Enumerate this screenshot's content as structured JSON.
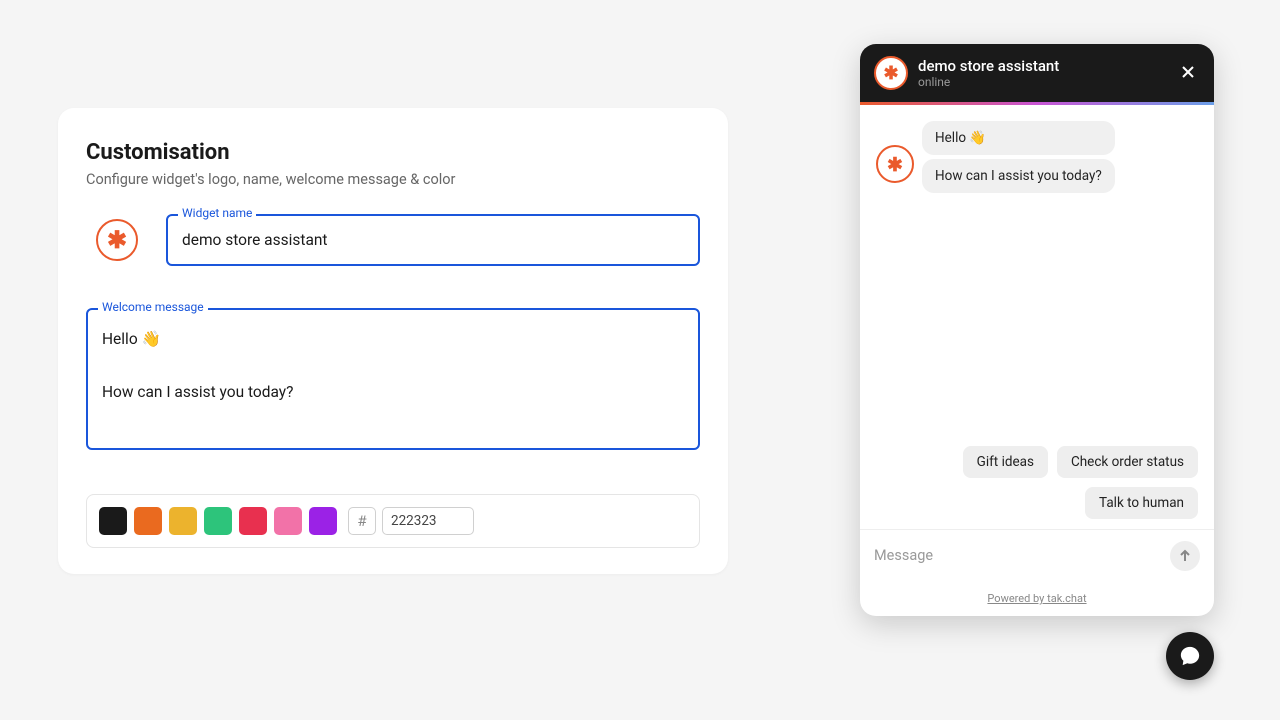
{
  "card": {
    "title": "Customisation",
    "subtitle": "Configure widget's logo, name, welcome message & color",
    "widget_name_label": "Widget name",
    "widget_name_value": "demo store assistant",
    "welcome_label": "Welcome message",
    "welcome_value": "Hello 👋\n\nHow can I assist you today?",
    "hash_symbol": "#",
    "hex_value": "222323",
    "swatches": [
      "#1a1a1a",
      "#ea6a1f",
      "#ecb32d",
      "#2dc47b",
      "#e8304f",
      "#f272a8",
      "#9b22e6"
    ]
  },
  "chat": {
    "title": "demo store assistant",
    "status": "online",
    "bubbles": [
      "Hello 👋",
      "How can I assist you today?"
    ],
    "chips": [
      "Gift ideas",
      "Check order status",
      "Talk to human"
    ],
    "input_placeholder": "Message",
    "footer": "Powered by tak.chat"
  }
}
